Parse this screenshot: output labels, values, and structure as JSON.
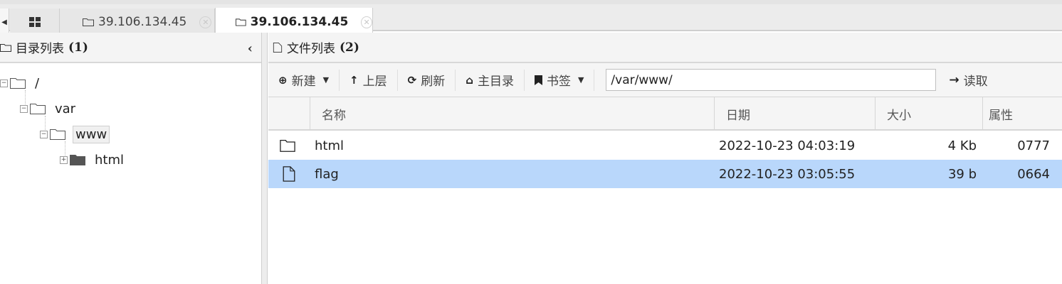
{
  "tabs": {
    "items": [
      {
        "label": "39.106.134.45",
        "active": false
      },
      {
        "label": "39.106.134.45",
        "active": true
      }
    ]
  },
  "dir_pane": {
    "title": "目录列表",
    "count": "(1)",
    "tree": {
      "root": "/",
      "var": "var",
      "www": "www",
      "html": "html"
    }
  },
  "file_pane": {
    "title": "文件列表",
    "count": "(2)",
    "toolbar": {
      "new_label": "新建",
      "up_label": "上层",
      "refresh_label": "刷新",
      "home_label": "主目录",
      "bookmark_label": "书签",
      "path_value": "/var/www/",
      "read_label": "读取"
    },
    "columns": {
      "name": "名称",
      "date": "日期",
      "size": "大小",
      "attr": "属性"
    },
    "rows": [
      {
        "type": "folder",
        "name": "html",
        "date": "2022-10-23 04:03:19",
        "size": "4 Kb",
        "attr": "0777",
        "selected": false
      },
      {
        "type": "file",
        "name": "flag",
        "date": "2022-10-23 03:05:55",
        "size": "39 b",
        "attr": "0664",
        "selected": true
      }
    ]
  },
  "colors": {
    "selected_row": "#b9d7fb",
    "header_bg": "#f5f5f5",
    "border": "#cfcfcf"
  }
}
